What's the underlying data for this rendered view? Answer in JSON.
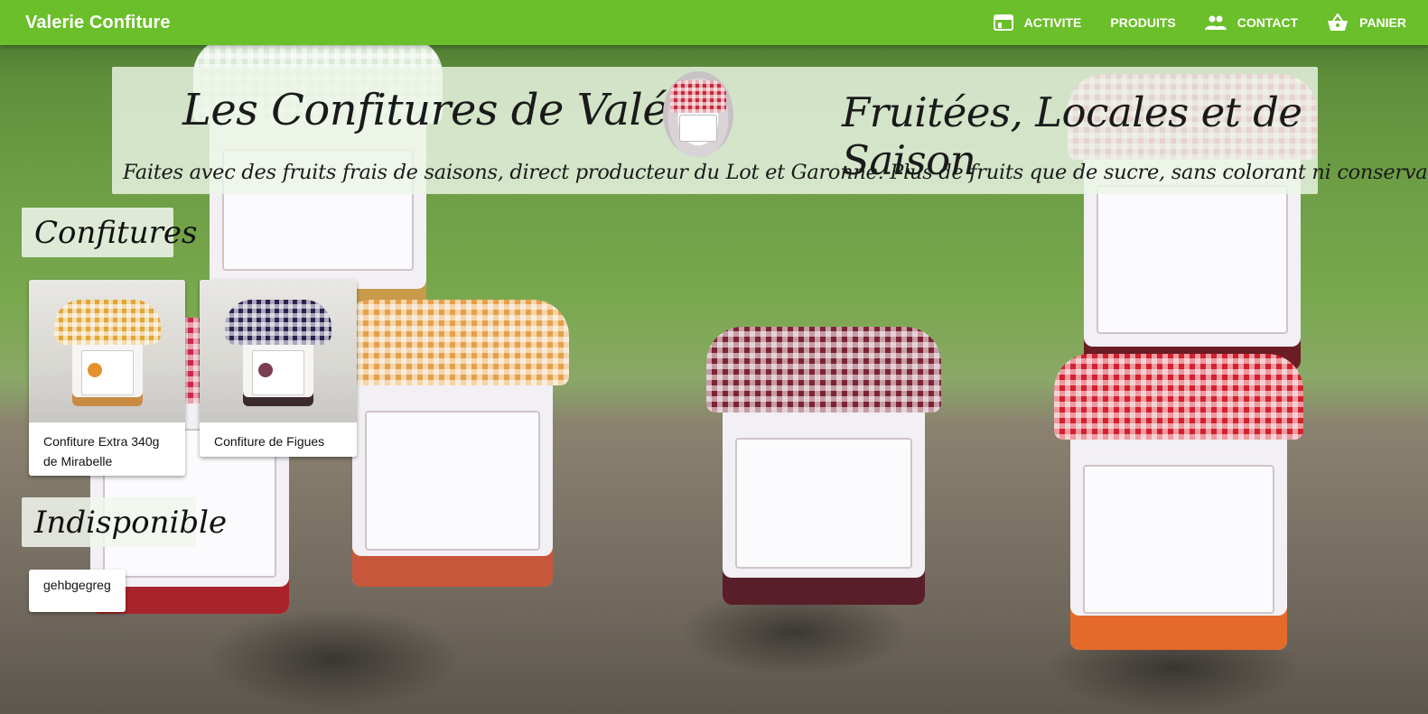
{
  "appbar": {
    "brand": "Valerie Confiture",
    "nav": [
      {
        "label": "ACTIVITE",
        "icon": "calendar-view-icon"
      },
      {
        "label": "PRODUITS",
        "icon": ""
      },
      {
        "label": "CONTACT",
        "icon": "people-icon"
      },
      {
        "label": "PANIER",
        "icon": "basket-icon"
      }
    ],
    "color": "#6bbf2a"
  },
  "banner": {
    "title": "Les Confitures de Valérie",
    "slogan": "Fruitées, Locales et de Saison",
    "subtitle": "Faites avec des fruits frais de saisons, direct producteur du Lot et Garonne. Plus de fruits que de sucre, sans colorant ni conservateurs."
  },
  "sections": {
    "available": {
      "heading": "Confitures",
      "products": [
        {
          "name": "Confiture Extra 340g de Mirabelle",
          "image": "mirabelle-jar-photo"
        },
        {
          "name": "Confiture de Figues",
          "image": "figues-jar-photo"
        }
      ]
    },
    "unavailable": {
      "heading": "Indisponible",
      "products": [
        {
          "name": "gehbgegreg"
        }
      ]
    }
  }
}
